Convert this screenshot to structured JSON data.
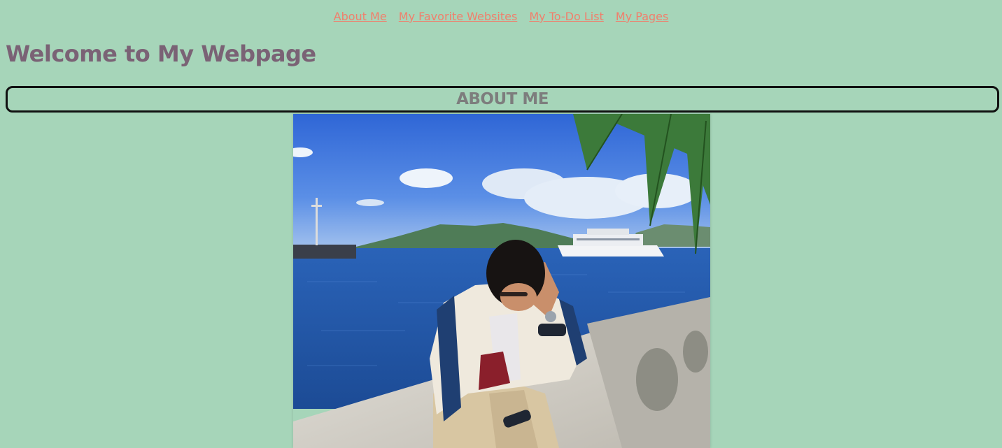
{
  "nav": {
    "items": [
      {
        "label": "About Me"
      },
      {
        "label": "My Favorite Websites"
      },
      {
        "label": "My To-Do List"
      },
      {
        "label": "My Pages"
      }
    ]
  },
  "page": {
    "title": "Welcome to My Webpage"
  },
  "section": {
    "title": "ABOUT ME"
  },
  "photo": {
    "subject": "profile-photo"
  },
  "colors": {
    "background": "#a6d5b9",
    "link": "#f07f6c",
    "title": "#7a6275",
    "section_title": "#7d7d7d"
  }
}
